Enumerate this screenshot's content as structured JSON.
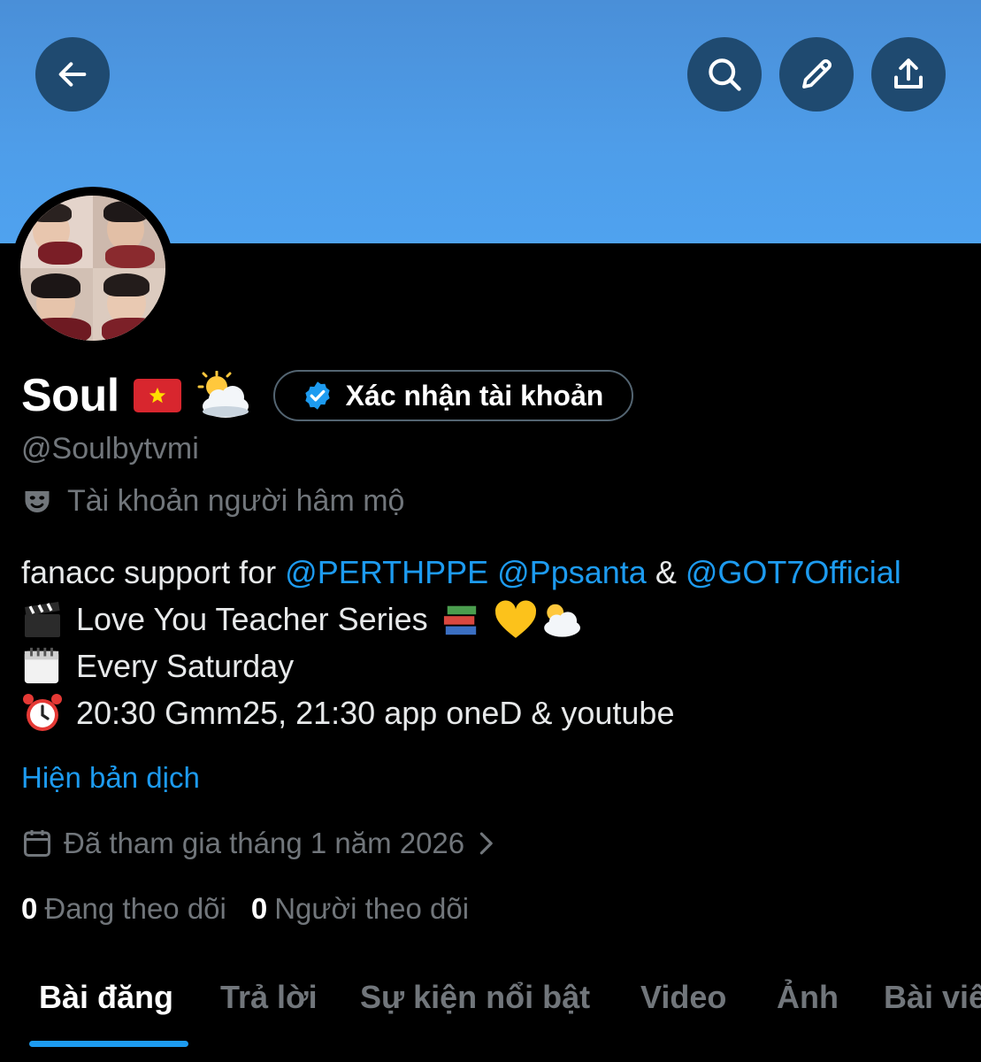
{
  "header": {
    "back_icon": "arrow-left-icon",
    "search_icon": "search-icon",
    "edit_icon": "pencil-icon",
    "share_icon": "share-upload-icon",
    "banner_color": "#4e9de9"
  },
  "profile": {
    "display_name": "Soul",
    "flag_icon": "vietnam-flag-icon",
    "name_emoji_icon": "sun-behind-cloud-icon",
    "verify_button_label": "Xác nhận tài khoản",
    "handle": "@Soulbytvmi",
    "fan_account_label": "Tài khoản người hâm mộ",
    "fan_account_icon": "theater-mask-icon",
    "bio": {
      "line1_prefix": "fanacc support for ",
      "mention1": "@PERTHPPE",
      "mention2": "@Ppsanta",
      "amp": "&",
      "mention3": "@GOT7Official",
      "line2": "Love You Teacher Series",
      "line3": "Every Saturday",
      "line4": "20:30 Gmm25, 21:30 app oneD & youtube"
    },
    "translate_link": "Hiện bản dịch",
    "joined": "Đã tham gia tháng 1 năm 2026",
    "following_count": "0",
    "following_label": "Đang theo dõi",
    "followers_count": "0",
    "followers_label": "Người theo dõi"
  },
  "tabs": [
    {
      "label": "Bài đăng",
      "active": true
    },
    {
      "label": "Trả lời",
      "active": false
    },
    {
      "label": "Sự kiện nổi bật",
      "active": false
    },
    {
      "label": "Video",
      "active": false
    },
    {
      "label": "Ảnh",
      "active": false
    },
    {
      "label": "Bài viết",
      "active": false
    }
  ],
  "colors": {
    "accent": "#1d9bf0",
    "muted_text": "#71767b",
    "background": "#000000"
  }
}
